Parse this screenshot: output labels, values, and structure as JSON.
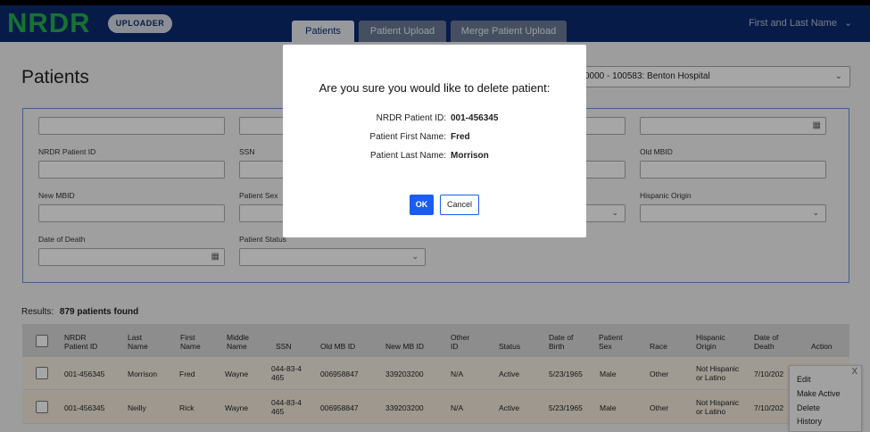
{
  "header": {
    "logo": "NRDR",
    "uploader_badge": "UPLOADER",
    "tabs": [
      {
        "label": "Patients",
        "active": true
      },
      {
        "label": "Patient Upload",
        "active": false
      },
      {
        "label": "Merge Patient Upload",
        "active": false
      }
    ],
    "user_menu": "First and Last Name"
  },
  "page": {
    "title": "Patients",
    "facility_select": "0000 - 100583:  Benton Hospital"
  },
  "filters": {
    "nrdr_patient_id_label": "NRDR Patient ID",
    "ssn_label": "SSN",
    "old_mbid_label": "Old MBID",
    "new_mbid_label": "New MBID",
    "patient_sex_label": "Patient Sex",
    "hispanic_origin_label": "Hispanic Origin",
    "date_of_death_label": "Date of Death",
    "patient_status_label": "Patient Status"
  },
  "results": {
    "label": "Results:",
    "count_text": "879 patients found"
  },
  "table": {
    "columns": [
      "NRDR\nPatient ID",
      "Last\nName",
      "First\nName",
      "Middle\nName",
      "SSN",
      "Old MB ID",
      "New MB ID",
      "Other\nID",
      "Status",
      "Date of\nBirth",
      "Patient\nSex",
      "Race",
      "Hispanic\nOrigin",
      "Date of\nDeath",
      "Action"
    ],
    "col_nrdr_id_1": "NRDR",
    "col_nrdr_id_2": "Patient ID",
    "col_last_1": "Last",
    "col_last_2": "Name",
    "col_first_1": "First",
    "col_first_2": "Name",
    "col_middle_1": "Middle",
    "col_middle_2": "Name",
    "col_ssn": "SSN",
    "col_old_mb": "Old MB ID",
    "col_new_mb": "New MB ID",
    "col_other_1": "Other",
    "col_other_2": "ID",
    "col_status": "Status",
    "col_dob_1": "Date of",
    "col_dob_2": "Birth",
    "col_sex_1": "Patient",
    "col_sex_2": "Sex",
    "col_race": "Race",
    "col_hisp_1": "Hispanic",
    "col_hisp_2": "Origin",
    "col_dod_1": "Date of",
    "col_dod_2": "Death",
    "col_action": "Action",
    "rows": [
      {
        "nrdr_id": "001-456345",
        "last": "Morrison",
        "first": "Fred",
        "middle": "Wayne",
        "ssn_1": "044-83-4",
        "ssn_2": "465",
        "old_mb": "006958847",
        "new_mb": "339203200",
        "other_id": "N/A",
        "status": "Active",
        "dob": "5/23/1965",
        "sex": "Male",
        "race": "Other",
        "hisp_1": "Not Hispanic",
        "hisp_2": "or Latino",
        "dod": "7/10/202"
      },
      {
        "nrdr_id": "001-456345",
        "last": "Neilly",
        "first": "Rick",
        "middle": "Wayne",
        "ssn_1": "044-83-4",
        "ssn_2": "465",
        "old_mb": "006958847",
        "new_mb": "339203200",
        "other_id": "N/A",
        "status": "Active",
        "dob": "5/23/1965",
        "sex": "Male",
        "race": "Other",
        "hisp_1": "Not Hispanic",
        "hisp_2": "or Latino",
        "dod": "7/10/202"
      }
    ]
  },
  "action_menu": {
    "close": "X",
    "items": [
      "Edit",
      "Make Active",
      "Delete",
      "History"
    ]
  },
  "dialog": {
    "title": "Are you sure you would like to delete patient:",
    "id_label": "NRDR Patient ID:",
    "id_value": "001-456345",
    "first_label": "Patient First Name:",
    "first_value": "Fred",
    "last_label": "Patient Last Name:",
    "last_value": "Morrison",
    "ok_label": "OK",
    "cancel_label": "Cancel"
  },
  "colors": {
    "header_bg": "#0b2a6f",
    "logo_green": "#22b14c",
    "primary_button": "#1a5df0",
    "row_highlight": "#f6eee0"
  }
}
